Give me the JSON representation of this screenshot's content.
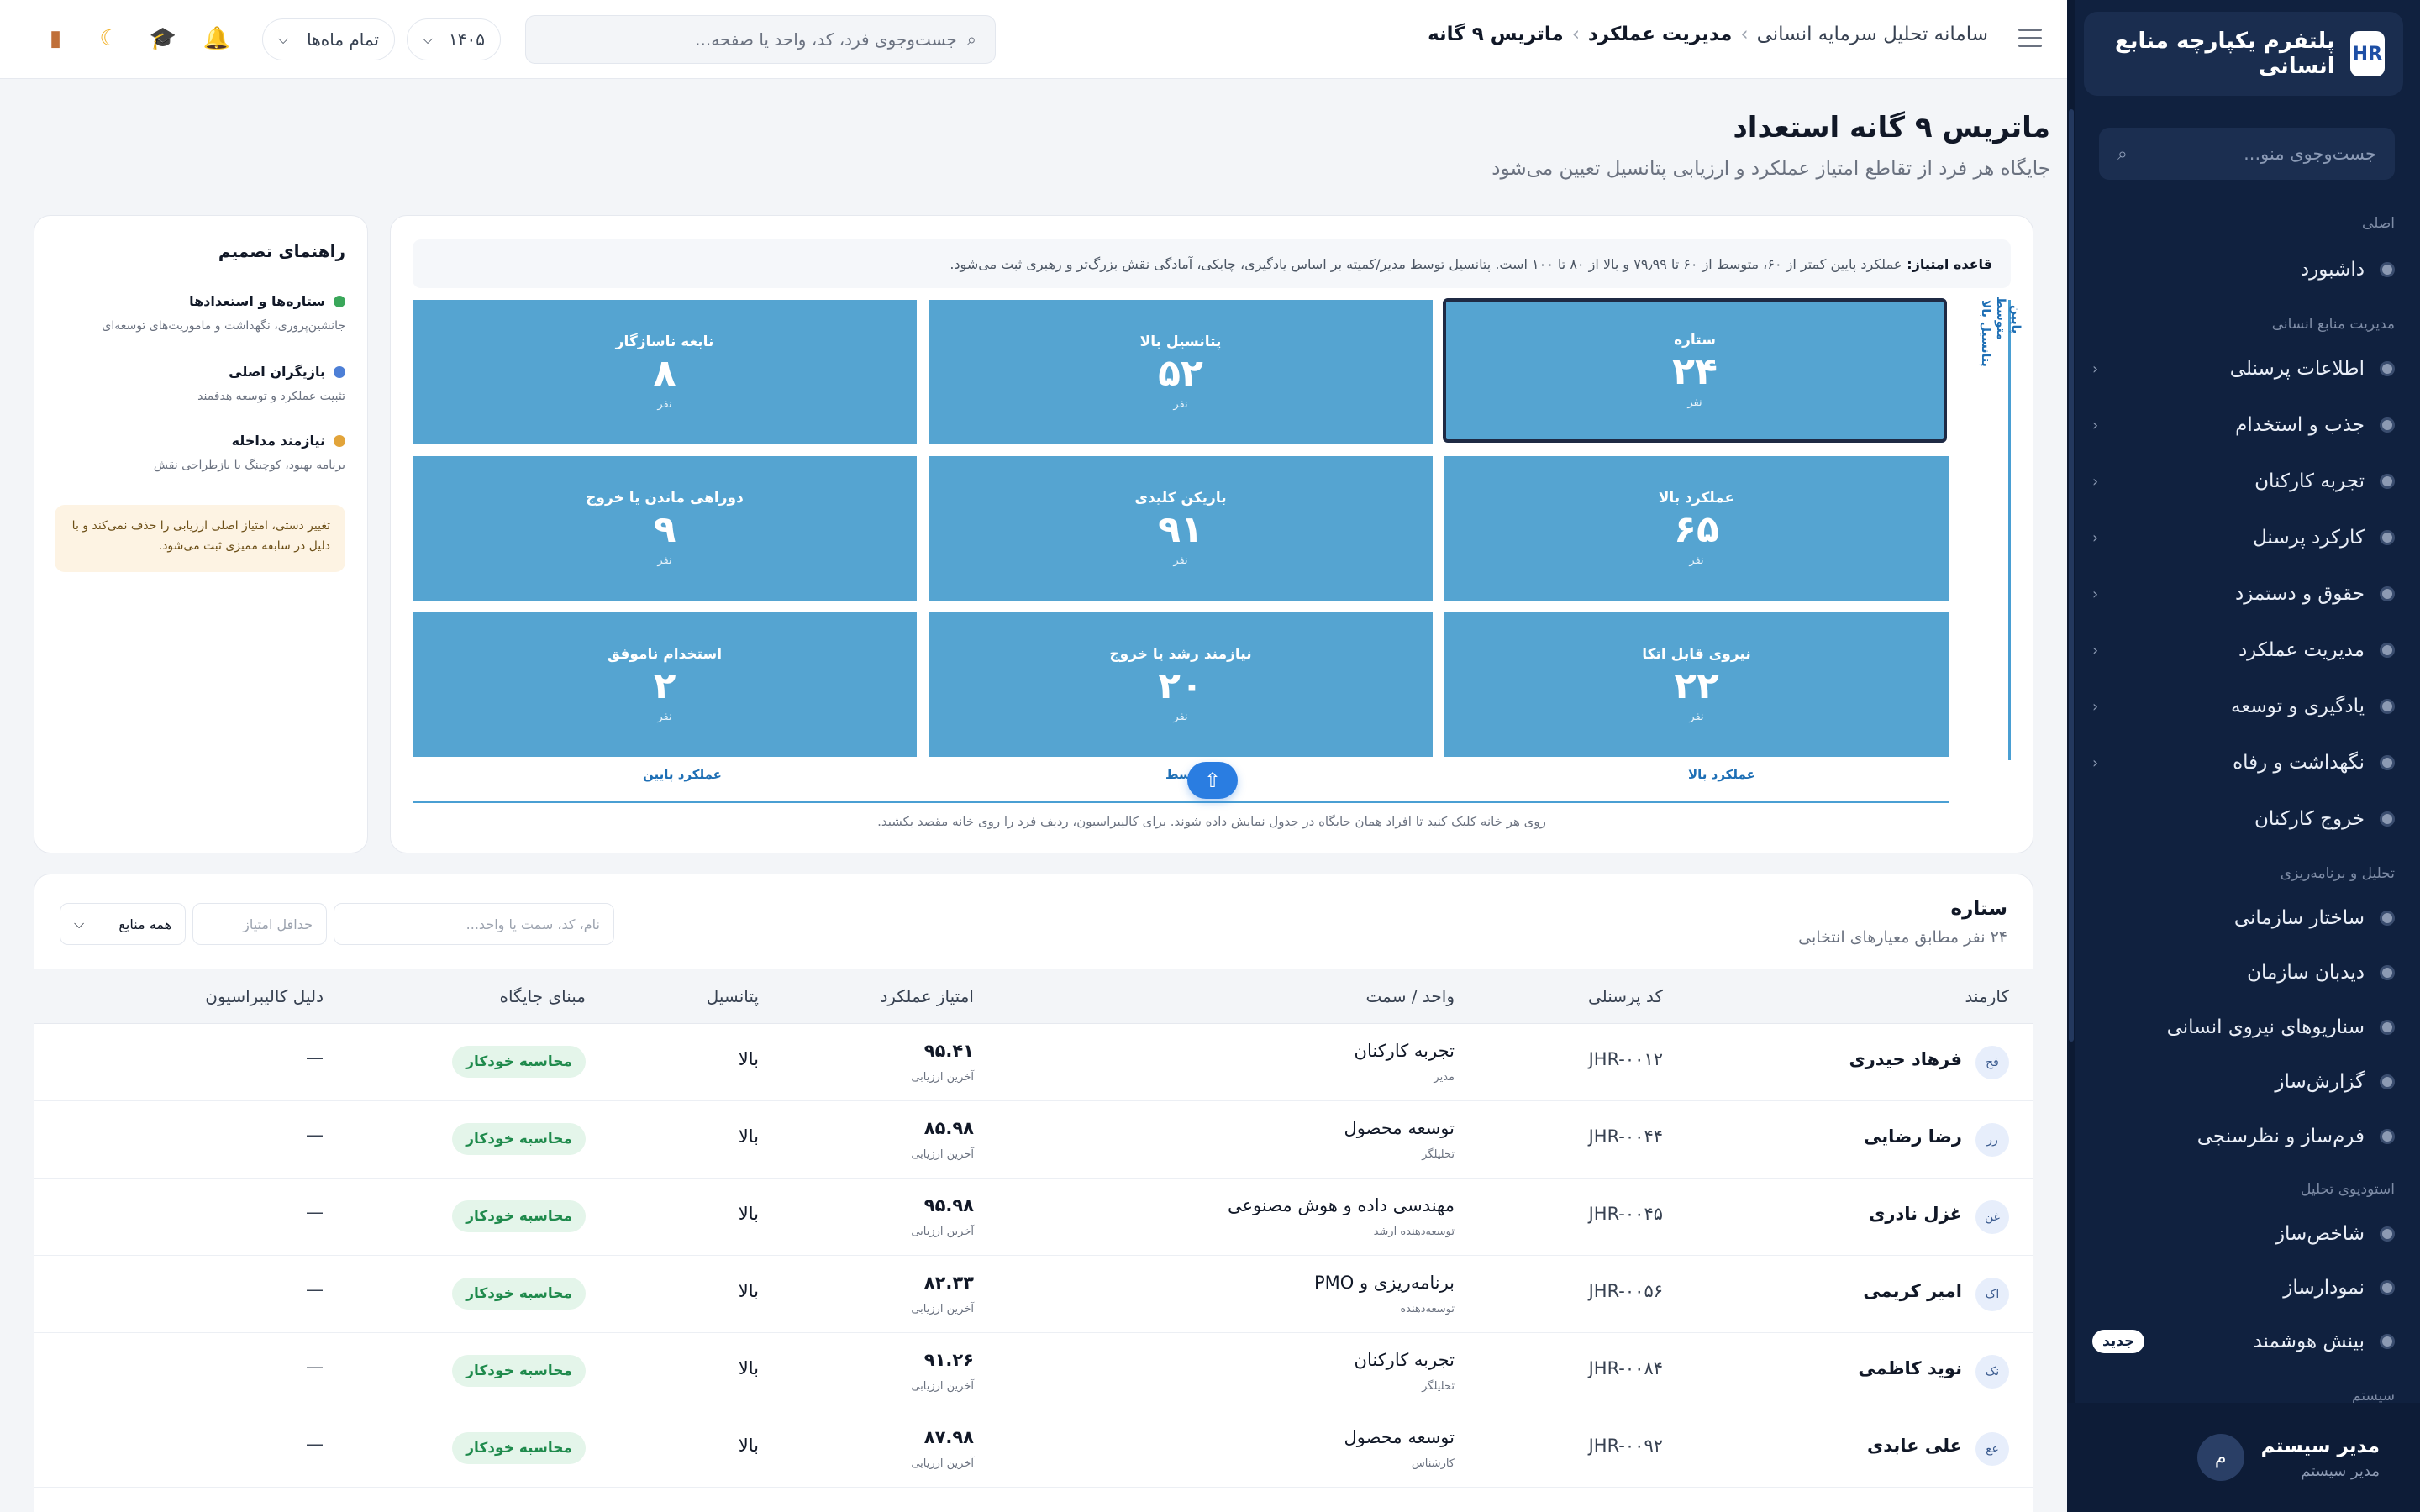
{
  "sidebar": {
    "brand_logo": "HR",
    "brand_title": "پلتفرم یکپارچه منابع انسانی",
    "search_placeholder": "جست‌وجوی منو...",
    "sections": [
      {
        "label": "اصلی"
      },
      {
        "label": "مدیریت منابع انسانی"
      },
      {
        "label": "تحلیل و برنامه‌ریزی"
      },
      {
        "label": "استودیوی تحلیل"
      },
      {
        "label": "سیستم"
      }
    ],
    "items": [
      {
        "label": "داشبورد"
      },
      {
        "label": "اطلاعات پرسنلی"
      },
      {
        "label": "جذب و استخدام"
      },
      {
        "label": "تجربه کارکنان"
      },
      {
        "label": "کارکرد پرسنل"
      },
      {
        "label": "حقوق و دستمزد"
      },
      {
        "label": "مدیریت عملکرد"
      },
      {
        "label": "یادگیری و توسعه"
      },
      {
        "label": "نگهداشت و رفاه"
      },
      {
        "label": "خروج کارکنان"
      },
      {
        "label": "ساختار سازمانی"
      },
      {
        "label": "دیدبان سازمان"
      },
      {
        "label": "سناریوهای نیروی انسانی"
      },
      {
        "label": "گزارش‌ساز"
      },
      {
        "label": "فرم‌ساز و نظرسنجی"
      },
      {
        "label": "شاخص‌ساز"
      },
      {
        "label": "نمودارساز"
      },
      {
        "label": "بینش هوشمند",
        "badge": "جدید"
      }
    ],
    "user": {
      "avatar": "م",
      "name": "مدیر سیستم",
      "role": "مدیر سیستم"
    }
  },
  "topbar": {
    "breadcrumb": [
      "سامانه تحلیل سرمایه انسانی",
      "مدیریت عملکرد",
      "ماتریس ۹ گانه"
    ],
    "search_placeholder": "جست‌وجوی فرد، کد، واحد یا صفحه...",
    "year": "۱۴۰۵",
    "period": "تمام ماه‌ها"
  },
  "page": {
    "title": "ماتریس ۹ گانه استعداد",
    "subtitle": "جایگاه هر فرد از تقاطع امتیاز عملکرد و ارزیابی پتانسیل تعیین می‌شود"
  },
  "matrix": {
    "rule_label": "قاعده امتیاز:",
    "rule_text": "عملکرد پایین کمتر از ۶۰، متوسط از ۶۰ تا ۷۹٫۹۹ و بالا از ۸۰ تا ۱۰۰ است. پتانسیل توسط مدیر/کمیته بر اساس یادگیری، چابکی، آمادگی نقش بزرگ‌تر و رهبری ثبت می‌شود.",
    "y_axis": {
      "high": "پتانسیل بالا",
      "mid": "متوسط",
      "low": "پایین"
    },
    "x_axis": {
      "high": "عملکرد بالا",
      "mid": "متوسط",
      "low": "عملکرد پایین"
    },
    "unit": "نفر",
    "cells": [
      {
        "title": "ستاره",
        "count": "۲۴",
        "active": true
      },
      {
        "title": "پتانسیل بالا",
        "count": "۵۲"
      },
      {
        "title": "نابغه ناسازگار",
        "count": "۸"
      },
      {
        "title": "عملکرد بالا",
        "count": "۶۵"
      },
      {
        "title": "بازیکن کلیدی",
        "count": "۹۱"
      },
      {
        "title": "دوراهی ماندن یا خروج",
        "count": "۹"
      },
      {
        "title": "نیروی قابل اتکا",
        "count": "۲۲"
      },
      {
        "title": "نیازمند رشد یا خروج",
        "count": "۲۰"
      },
      {
        "title": "استخدام ناموفق",
        "count": "۲"
      }
    ],
    "hint": "روی هر خانه کلیک کنید تا افراد همان جایگاه در جدول نمایش داده شوند. برای کالیبراسیون، ردیف فرد را روی خانه مقصد بکشید."
  },
  "guide": {
    "title": "راهنمای تصمیم",
    "items": [
      {
        "title": "ستاره‌ها و استعدادها",
        "desc": "جانشین‌پروری، نگهداشت و ماموریت‌های توسعه‌ای",
        "color": "#3aa75a"
      },
      {
        "title": "بازیگران اصلی",
        "desc": "تثبیت عملکرد و توسعه هدفمند",
        "color": "#4d7fd6"
      },
      {
        "title": "نیازمند مداخله",
        "desc": "برنامه بهبود، کوچینگ یا بازطراحی نقش",
        "color": "#e2a43a"
      }
    ],
    "note": "تغییر دستی، امتیاز اصلی ارزیابی را حذف نمی‌کند و با دلیل در سابقه ممیزی ثبت می‌شود."
  },
  "table": {
    "title": "ستاره",
    "subtitle": "۲۴ نفر مطابق معیارهای انتخابی",
    "search_placeholder": "نام، کد، سمت یا واحد...",
    "min_score_placeholder": "حداقل امتیاز",
    "source_select": "همه منابع",
    "columns": [
      "کارمند",
      "کد پرسنلی",
      "واحد / سمت",
      "امتیاز عملکرد",
      "پتانسیل",
      "مبنای جایگاه",
      "دلیل کالیبراسیون"
    ],
    "rows": [
      {
        "initials": "فح",
        "name": "فرهاد حیدری",
        "code": "JHR-۰۰۱۲",
        "unit": "تجربه کارکنان",
        "role": "مدیر",
        "score": "۹۵.۴۱",
        "score_note": "آخرین ارزیابی",
        "potential": "بالا",
        "basis": "محاسبه خودکار",
        "reason": "—"
      },
      {
        "initials": "رر",
        "name": "رضا رضایی",
        "code": "JHR-۰۰۴۴",
        "unit": "توسعه محصول",
        "role": "تحلیلگر",
        "score": "۸۵.۹۸",
        "score_note": "آخرین ارزیابی",
        "potential": "بالا",
        "basis": "محاسبه خودکار",
        "reason": "—"
      },
      {
        "initials": "غن",
        "name": "غزل نادری",
        "code": "JHR-۰۰۴۵",
        "unit": "مهندسی داده و هوش مصنوعی",
        "role": "توسعه‌دهنده ارشد",
        "score": "۹۵.۹۸",
        "score_note": "آخرین ارزیابی",
        "potential": "بالا",
        "basis": "محاسبه خودکار",
        "reason": "—"
      },
      {
        "initials": "اک",
        "name": "امیر کریمی",
        "code": "JHR-۰۰۵۶",
        "unit": "برنامه‌ریزی و PMO",
        "role": "توسعه‌دهنده",
        "score": "۸۲.۳۳",
        "score_note": "آخرین ارزیابی",
        "potential": "بالا",
        "basis": "محاسبه خودکار",
        "reason": "—"
      },
      {
        "initials": "نک",
        "name": "نوید کاظمی",
        "code": "JHR-۰۰۸۴",
        "unit": "تجربه کارکنان",
        "role": "تحلیلگر",
        "score": "۹۱.۲۶",
        "score_note": "آخرین ارزیابی",
        "potential": "بالا",
        "basis": "محاسبه خودکار",
        "reason": "—"
      },
      {
        "initials": "عع",
        "name": "علی عابدی",
        "code": "JHR-۰۰۹۲",
        "unit": "توسعه محصول",
        "role": "کارشناس",
        "score": "۸۷.۹۸",
        "score_note": "آخرین ارزیابی",
        "potential": "بالا",
        "basis": "محاسبه خودکار",
        "reason": "—"
      }
    ]
  },
  "colors": {
    "sidebar_bg": "#10213f",
    "matrix_cell": "#55a4d1",
    "accent": "#2a7de1",
    "badge_green": "#1f8a4c"
  }
}
